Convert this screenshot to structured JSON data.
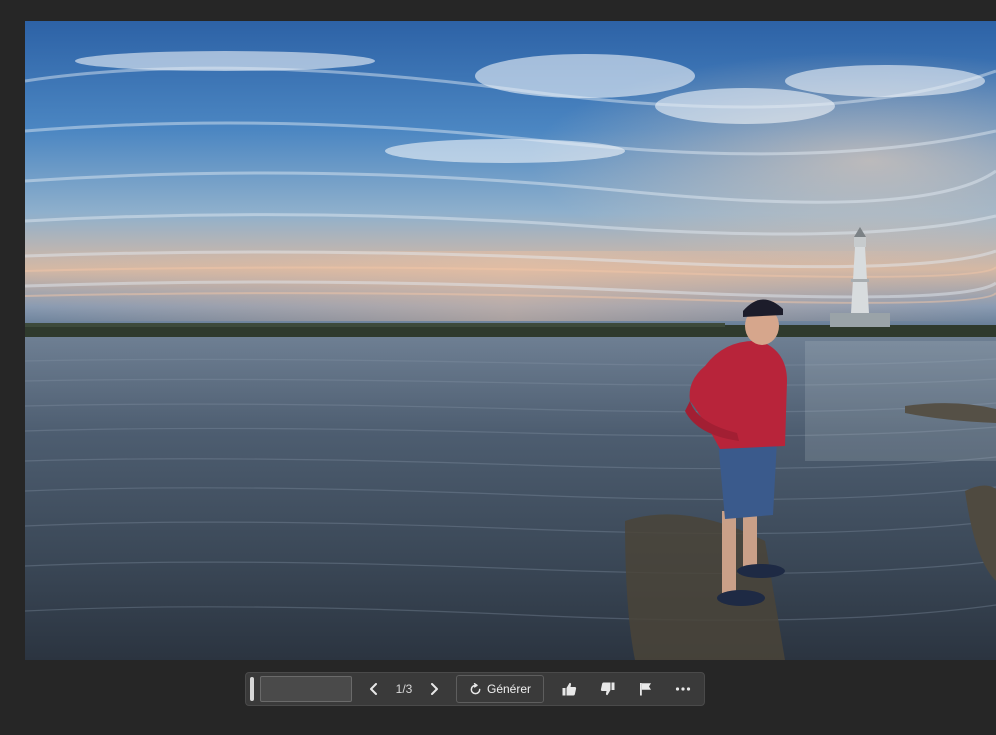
{
  "photo": {
    "description_icon": "photo-canvas"
  },
  "toolbar": {
    "prompt_value": "",
    "counter": "1/3",
    "generate_label": "Générer",
    "icons": [
      "prev-chevron-icon",
      "next-chevron-icon",
      "regenerate-icon",
      "thumbs-up-icon",
      "thumbs-down-icon",
      "flag-icon",
      "more-icon"
    ]
  },
  "colors": {
    "background": "#262626",
    "toolbar_bg": "#3a3a3a",
    "toolbar_border": "#4a4a4a",
    "text": "#e8e8e8"
  }
}
